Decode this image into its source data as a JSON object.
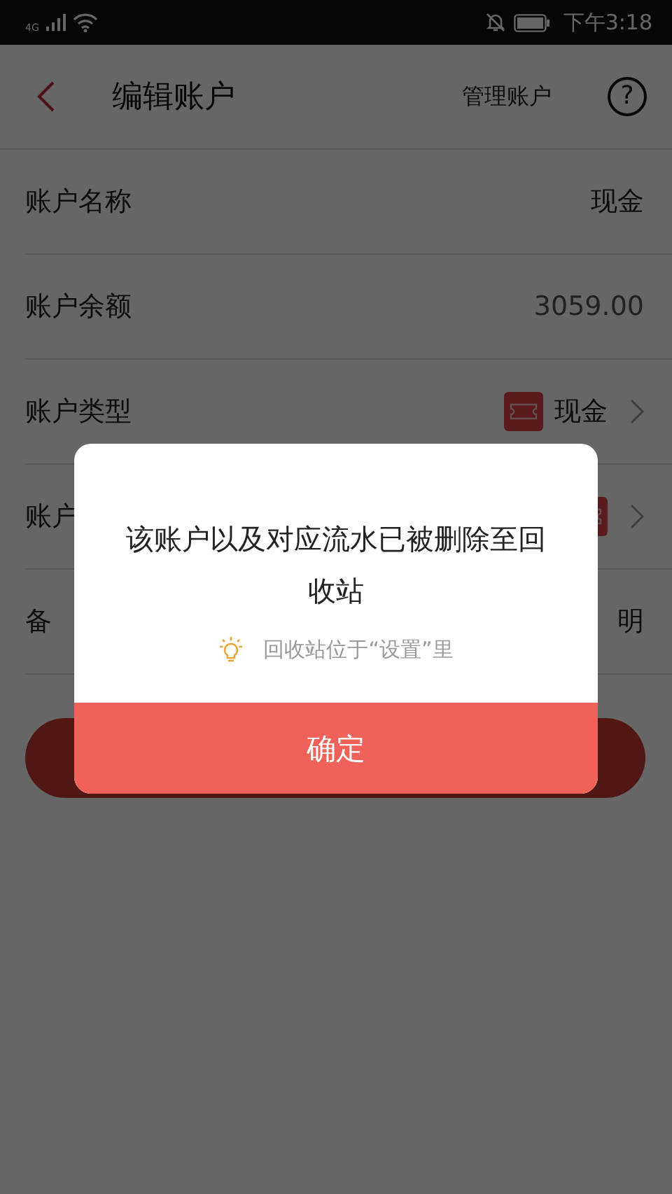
{
  "status_bar": {
    "network": "4G",
    "time": "下午3:18"
  },
  "header": {
    "title": "编辑账户",
    "action": "管理账户",
    "help": "?"
  },
  "rows": [
    {
      "kind": "text",
      "label": "账户名称",
      "value": "现金"
    },
    {
      "kind": "amount",
      "label": "账户余额",
      "value": "3059.00"
    },
    {
      "kind": "type",
      "label": "账户类型",
      "value": "现金"
    },
    {
      "kind": "type",
      "label": "账户"
    },
    {
      "kind": "text",
      "label": "备",
      "value": "明"
    }
  ],
  "dialog": {
    "message": "该账户以及对应流水已被删除至回收站",
    "tip": "回收站位于“设置”里",
    "confirm": "确定"
  }
}
